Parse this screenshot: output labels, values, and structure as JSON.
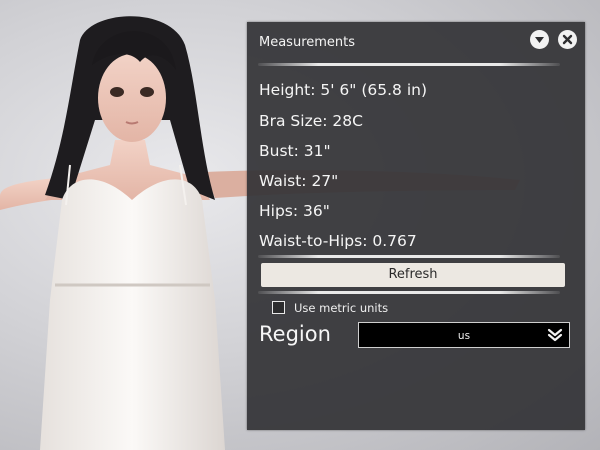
{
  "panel": {
    "title": "Measurements",
    "icons": {
      "minimize": "chevron-down-icon",
      "close": "close-icon"
    },
    "stats": [
      {
        "text": "Height: 5' 6\" (65.8 in)"
      },
      {
        "text": "Bra Size: 28C"
      },
      {
        "text": "Bust: 31\""
      },
      {
        "text": "Waist: 27\""
      },
      {
        "text": "Hips: 36\""
      },
      {
        "text": "Waist-to-Hips: 0.767"
      }
    ],
    "refresh_label": "Refresh",
    "metric_units": {
      "label": "Use metric units",
      "checked": false
    },
    "region": {
      "label": "Region",
      "value": "us"
    }
  },
  "colors": {
    "panel_bg": "#343437",
    "button_bg": "#ece8e2",
    "select_bg": "#000000"
  }
}
